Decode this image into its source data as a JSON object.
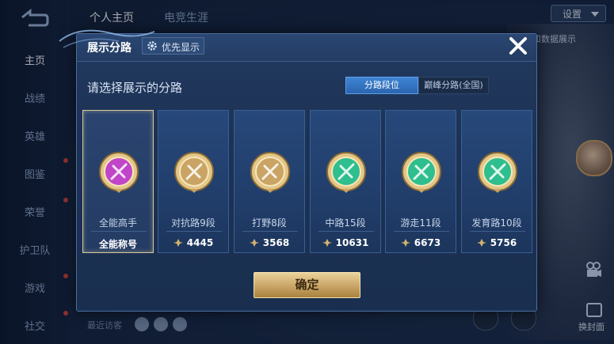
{
  "nav": {
    "items": [
      "主页",
      "战绩",
      "英雄",
      "图鉴",
      "荣誉",
      "护卫队",
      "游戏",
      "社交"
    ]
  },
  "top_tabs": [
    "个人主页",
    "电竞生涯"
  ],
  "settings_label": "设置",
  "bg_link": "和数据展示",
  "cover_label": "换封面",
  "recent_visitors_label": "最近访客",
  "modal": {
    "title": "展示分路",
    "priority_button": "优先显示",
    "subtitle": "请选择展示的分路",
    "segments": [
      "分路段位",
      "巅峰分路(全国)"
    ],
    "confirm": "确定",
    "cards": [
      {
        "name": "全能高手",
        "score": "全能称号",
        "color": "#c045c9",
        "selected": true
      },
      {
        "name": "对抗路9段",
        "score": "4445",
        "color": "#c9a464",
        "selected": false
      },
      {
        "name": "打野8段",
        "score": "3568",
        "color": "#c9a464",
        "selected": false
      },
      {
        "name": "中路15段",
        "score": "10631",
        "color": "#2fbe8d",
        "selected": false
      },
      {
        "name": "游走11段",
        "score": "6673",
        "color": "#2fbe8d",
        "selected": false
      },
      {
        "name": "发育路10段",
        "score": "5756",
        "color": "#2fbe8d",
        "selected": false
      }
    ]
  },
  "colors": {
    "accent": "#3f85d3",
    "gold": "#c9a466",
    "purple": "#c045c9",
    "teal": "#2fbe8d"
  }
}
